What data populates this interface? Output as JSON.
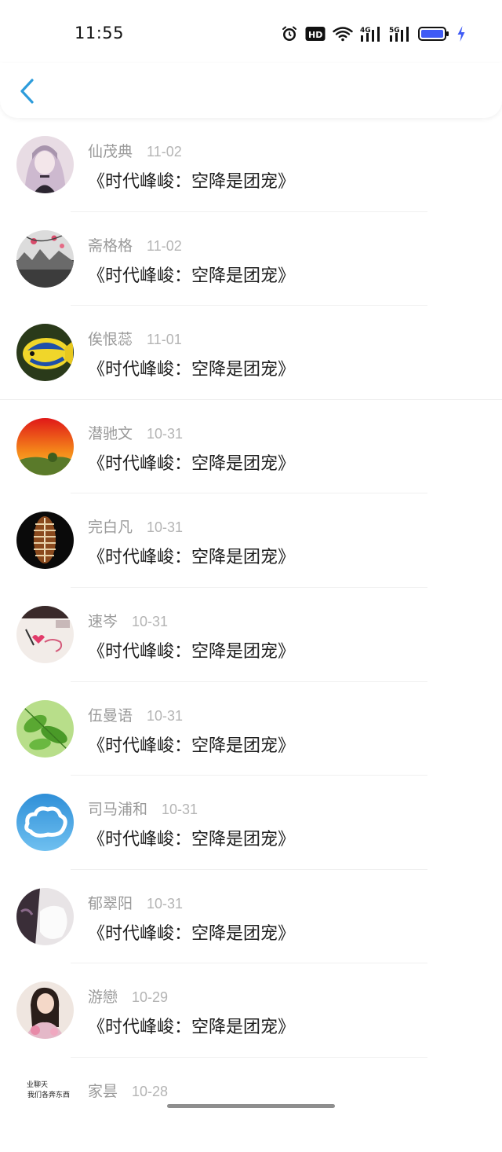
{
  "status_bar": {
    "time": "11:55",
    "icons": [
      "alarm-icon",
      "hd-icon",
      "wifi-icon",
      "4g-signal-icon",
      "5g-signal-icon",
      "battery-icon",
      "charging-icon"
    ],
    "hd_label": "HD",
    "net_4g": "4G",
    "net_5g": "5G",
    "battery_color": "#3f5bf5"
  },
  "nav": {
    "back_icon": "chevron-left-icon",
    "accent": "#2d9cdb"
  },
  "comments": [
    {
      "name": "仙茂典",
      "date": "11-02",
      "text": "《时代峰峻：空降是团宠》"
    },
    {
      "name": "斋格格",
      "date": "11-02",
      "text": "《时代峰峻：空降是团宠》"
    },
    {
      "name": "俟恨蕊",
      "date": "11-01",
      "text": "《时代峰峻：空降是团宠》"
    },
    {
      "name": "潜驰文",
      "date": "10-31",
      "text": "《时代峰峻：空降是团宠》"
    },
    {
      "name": "完白凡",
      "date": "10-31",
      "text": "《时代峰峻：空降是团宠》"
    },
    {
      "name": "速岑",
      "date": "10-31",
      "text": "《时代峰峻：空降是团宠》"
    },
    {
      "name": "伍曼语",
      "date": "10-31",
      "text": "《时代峰峻：空降是团宠》"
    },
    {
      "name": "司马浦和",
      "date": "10-31",
      "text": "《时代峰峻：空降是团宠》"
    },
    {
      "name": "郁翠阳",
      "date": "10-31",
      "text": "《时代峰峻：空降是团宠》"
    },
    {
      "name": "游戀",
      "date": "10-29",
      "text": "《时代峰峻：空降是团宠》"
    },
    {
      "name": "家昙",
      "date": "10-28",
      "text": "",
      "avatar_text_line1": "业聊天",
      "avatar_text_line2": "我们各奔东西"
    }
  ]
}
